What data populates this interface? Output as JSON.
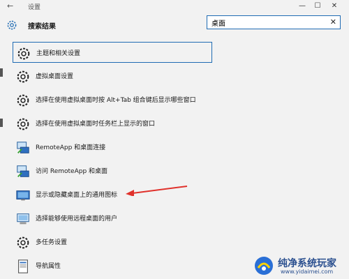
{
  "window": {
    "title": "设置",
    "minimize": "—",
    "maximize": "☐",
    "close": "✕",
    "back": "←"
  },
  "header": {
    "title": "搜索结果",
    "icon": "gear-icon"
  },
  "search": {
    "value": "桌面",
    "clear": "✕"
  },
  "results": [
    {
      "label": "主题和相关设置",
      "icon": "gear-icon",
      "selected": true
    },
    {
      "label": "虚拟桌面设置",
      "icon": "gear-icon"
    },
    {
      "label": "选择在使用虚拟桌面时按 Alt+Tab 组合键后显示哪些窗口",
      "icon": "gear-icon"
    },
    {
      "label": "选择在使用虚拟桌面时任务栏上显示的窗口",
      "icon": "gear-icon"
    },
    {
      "label": "RemoteApp 和桌面连接",
      "icon": "remoteapp-icon"
    },
    {
      "label": "访问 RemoteApp 和桌面",
      "icon": "remoteapp-icon"
    },
    {
      "label": "显示或隐藏桌面上的通用图标",
      "icon": "desktop-icon"
    },
    {
      "label": "选择能够使用远程桌面的用户",
      "icon": "remote-desktop-icon"
    },
    {
      "label": "多任务设置",
      "icon": "gear-icon"
    },
    {
      "label": "导航属性",
      "icon": "navigation-properties-icon"
    }
  ],
  "watermark": {
    "text": "纯净系统玩家",
    "url": "www.yidaimei.com"
  },
  "colors": {
    "accent": "#1f6bb3",
    "arrow": "#e0312b"
  }
}
